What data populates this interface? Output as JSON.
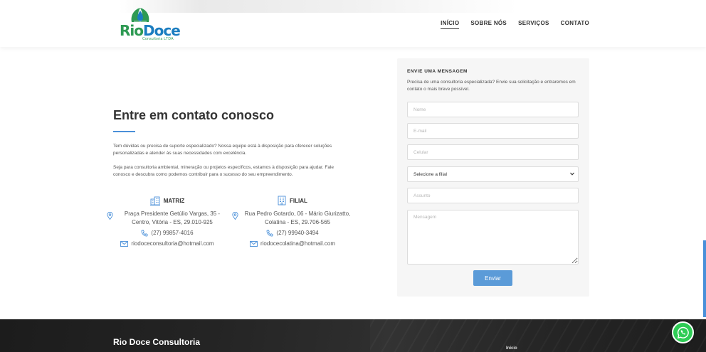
{
  "brand": {
    "logo_word_1": "Rio",
    "logo_word_2": "Doce",
    "logo_sub": "Consultoria LTDA",
    "green": "#2e9a53",
    "blue": "#1b7dc0"
  },
  "nav": {
    "items": [
      {
        "label": "INÍCIO",
        "active": true
      },
      {
        "label": "SOBRE NÓS",
        "active": false
      },
      {
        "label": "SERVIÇOS",
        "active": false
      },
      {
        "label": "CONTATO",
        "active": false
      }
    ]
  },
  "contact": {
    "title": "Entre em contato conosco",
    "para1": "Tem dúvidas ou precisa de suporte especializado? Nossa equipe está à disposição para oferecer soluções personalizadas e atender às suas necessidades com excelência.",
    "para2": "Seja para consultoria ambiental, mineração ou projetos específicos, estamos à disposição para ajudar. Fale conosco e descubra como podemos contribuir para o sucesso do seu empreendimento.",
    "offices": [
      {
        "name": "MATRIZ",
        "address": "Praça Presidente Getúlio Vargas, 35 - Centro, Vitória - ES, 29.010-925",
        "phone": "(27) 99857-4016",
        "email": "riodoceconsultoria@hotmail.com"
      },
      {
        "name": "FILIAL",
        "address": "Rua Pedro Gotardo, 06 - Mário Giurizatto, Colatina - ES, 29.706-565",
        "phone": "(27) 99940-3494",
        "email": "riodocecolatina@hotmail.com"
      }
    ]
  },
  "form": {
    "title": "ENVIE UMA MENSAGEM",
    "description": "Precisa de uma consultoria especializada? Envie sua solicitação e entraremos em contato o mais breve possível.",
    "name_placeholder": "Nome",
    "email_placeholder": "E-mail",
    "phone_placeholder": "Celular",
    "branch_selected": "Selecione a filial",
    "subject_placeholder": "Assunto",
    "message_placeholder": "Mensagem",
    "submit_label": "Enviar",
    "accent": "#5b9bd8"
  },
  "footer": {
    "title": "Rio Doce Consultoria",
    "link_home": "Início"
  },
  "icons": {
    "matriz": "buildings-icon",
    "filial": "office-building-icon",
    "location": "map-pin-icon",
    "phone": "phone-icon",
    "email": "envelope-icon",
    "whatsapp": "whatsapp-icon"
  }
}
